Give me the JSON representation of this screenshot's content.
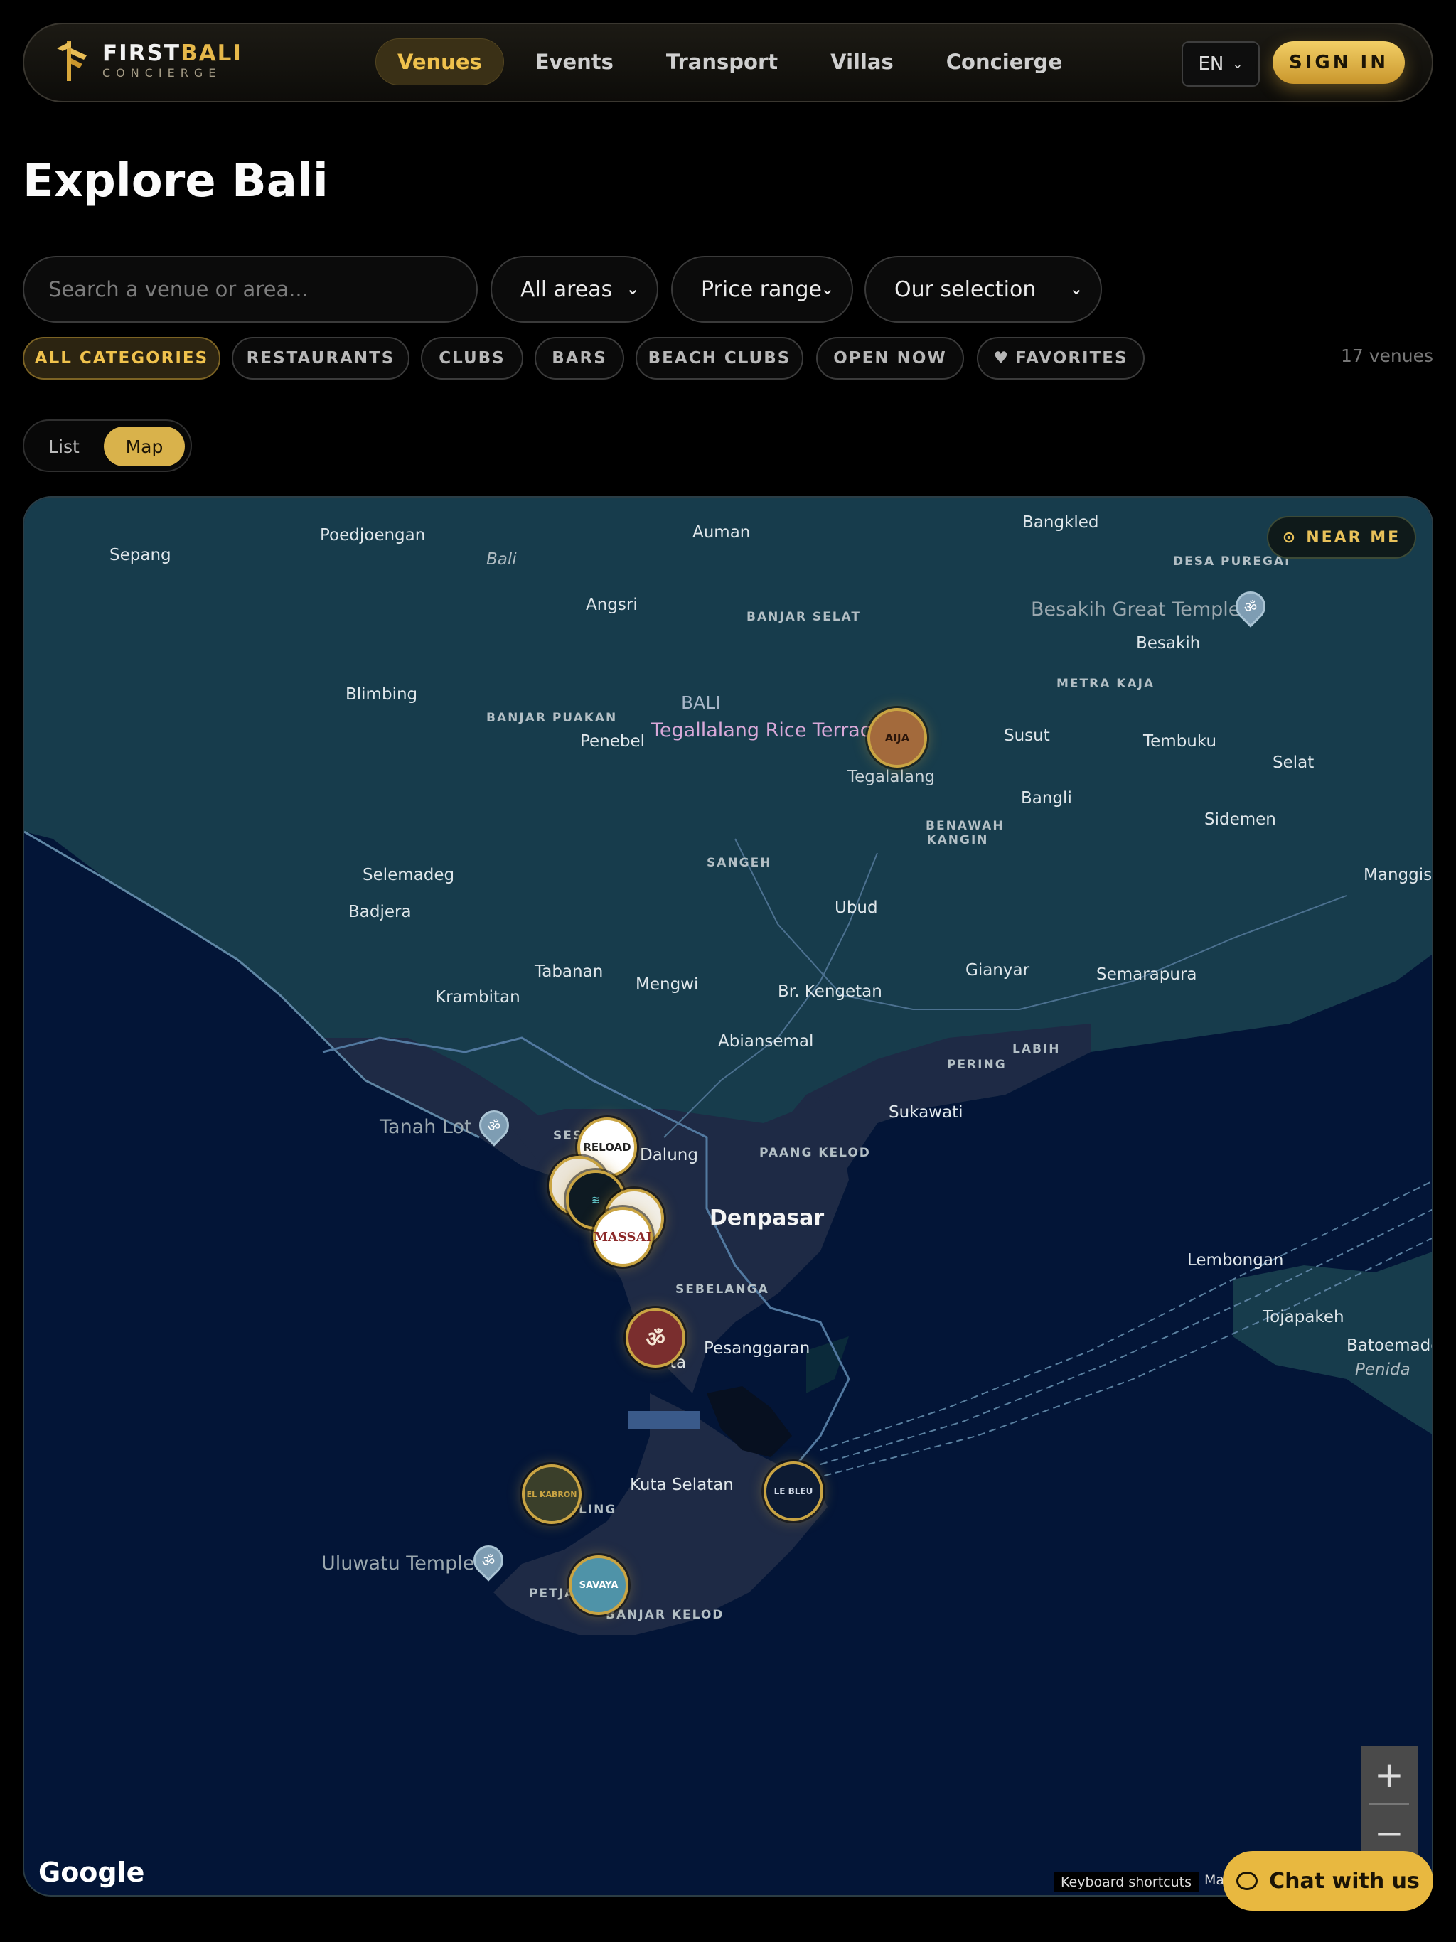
{
  "brand": {
    "word1": "FIRST",
    "word2": "BALI",
    "tagline": "CONCIERGE"
  },
  "nav": {
    "items": [
      "Venues",
      "Events",
      "Transport",
      "Villas",
      "Concierge"
    ],
    "active": "Venues",
    "language": "EN",
    "signin": "SIGN IN"
  },
  "page_title": "Explore Bali",
  "filters": {
    "search_placeholder": "Search a venue or area...",
    "area": "All areas",
    "price": "Price range",
    "sort": "Our selection"
  },
  "categories": [
    "ALL CATEGORIES",
    "RESTAURANTS",
    "CLUBS",
    "BARS",
    "BEACH CLUBS",
    "OPEN NOW",
    "FAVORITES"
  ],
  "venue_count": "17 venues",
  "view_toggle": {
    "list": "List",
    "map": "Map",
    "active": "Map"
  },
  "map": {
    "near_me": "NEAR ME",
    "labels": {
      "sepang": "Sepang",
      "poedjoengan": "Poedjoengan",
      "bali_it": "Bali",
      "auman": "Auman",
      "bangkled": "Bangkled",
      "desa_puregai": "DESA PUREGAI",
      "angsri": "Angsri",
      "banjar_selat": "BANJAR SELAT",
      "besakih_temple": "Besakih Great Temple",
      "besakih": "Besakih",
      "metra_kaja": "METRA KAJA",
      "blimbing": "Blimbing",
      "bali": "BALI",
      "banjar_puakan": "BANJAR PUAKAN",
      "tegallalang_rice": "Tegallalang Rice Terrace",
      "penebel": "Penebel",
      "susut": "Susut",
      "tembuku": "Tembuku",
      "selat": "Selat",
      "tegalalang": "Tegalalang",
      "bangli": "Bangli",
      "benawah": "BENAWAH KANGIN",
      "sidemen": "Sidemen",
      "sangeh": "SANGEH",
      "selemadeg": "Selemadeg",
      "manggis": "Manggis",
      "badjera": "Badjera",
      "ubud": "Ubud",
      "gianyar": "Gianyar",
      "tabanan": "Tabanan",
      "semarapura": "Semarapura",
      "krambitan": "Krambitan",
      "mengwi": "Mengwi",
      "kengetan": "Br. Kengetan",
      "abiansemal": "Abiansemal",
      "pering": "PERING",
      "labih": "LABIH",
      "sukawati": "Sukawati",
      "tanah_lot": "Tanah Lot",
      "dalung": "Dalung",
      "paang_kelod": "PAANG KELOD",
      "denpasar": "Denpasar",
      "lembongan": "Lembongan",
      "sebelanga": "SEBELANGA",
      "tojapakeh": "Tojapakeh",
      "pesanggaran": "Pesanggaran",
      "batoemade": "Batoemade",
      "penida": "Penida",
      "kuta_selatan": "Kuta Selatan",
      "uluwatu": "Uluwatu Temple",
      "banjar_kelod": "BANJAR KELOD",
      "petja": "PETJA",
      "ling": "LING",
      "ta": "ta",
      "ses": "SES"
    },
    "markers": [
      {
        "name": "AIJA",
        "color": "#a36a3c"
      },
      {
        "name": "RELOAD",
        "color": "#ffffff"
      },
      {
        "name": "MASSAI",
        "color": "#ffffff"
      },
      {
        "name": "LE BLEU",
        "color": "#0d1b33"
      },
      {
        "name": "SAVAYA",
        "color": "#4f93a8"
      },
      {
        "name": "EL KABRON",
        "color": "#3a3f2a"
      }
    ],
    "attribution_logo": "Google",
    "keyboard": "Keyboard shortcuts",
    "map_data": "Ma"
  },
  "chat": "Chat with us",
  "colors": {
    "accent": "#e6b84a",
    "background": "#000000",
    "sea": "#031537",
    "land": "#1d2a44"
  }
}
